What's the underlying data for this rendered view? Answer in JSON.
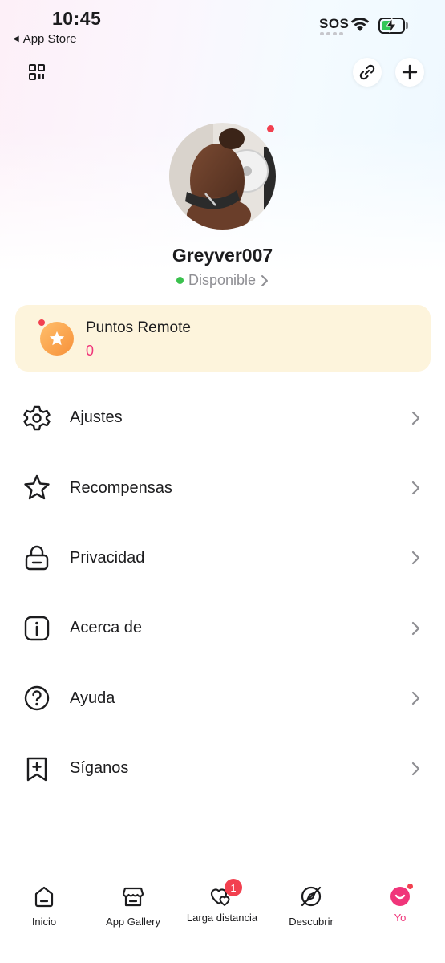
{
  "status_bar": {
    "time": "10:45",
    "back_app": "App Store",
    "carrier": "SOS",
    "battery_level": 0.5
  },
  "header": {
    "icons": [
      "qr-code-icon",
      "link-icon",
      "plus-icon"
    ]
  },
  "profile": {
    "username": "Greyver007",
    "status": "Disponible",
    "status_color": "#3ac14d"
  },
  "points": {
    "title": "Puntos Remote",
    "value": "0",
    "accent": "#f0357a",
    "card_bg": "#fdf4dc"
  },
  "menu": {
    "items": [
      {
        "label": "Ajustes",
        "icon": "gear-icon"
      },
      {
        "label": "Recompensas",
        "icon": "star-icon"
      },
      {
        "label": "Privacidad",
        "icon": "lock-icon"
      },
      {
        "label": "Acerca de",
        "icon": "info-icon"
      },
      {
        "label": "Ayuda",
        "icon": "help-icon"
      },
      {
        "label": "Síganos",
        "icon": "bookmark-plus-icon"
      }
    ]
  },
  "bottom_nav": {
    "items": [
      {
        "label": "Inicio",
        "icon": "home-icon"
      },
      {
        "label": "App Gallery",
        "icon": "store-icon"
      },
      {
        "label": "Larga distancia",
        "icon": "hearts-icon",
        "badge": "1"
      },
      {
        "label": "Descubrir",
        "icon": "compass-icon"
      },
      {
        "label": "Yo",
        "icon": "profile-icon",
        "active": true
      }
    ],
    "active_color": "#f0357a",
    "badge_color": "#f2404f"
  }
}
